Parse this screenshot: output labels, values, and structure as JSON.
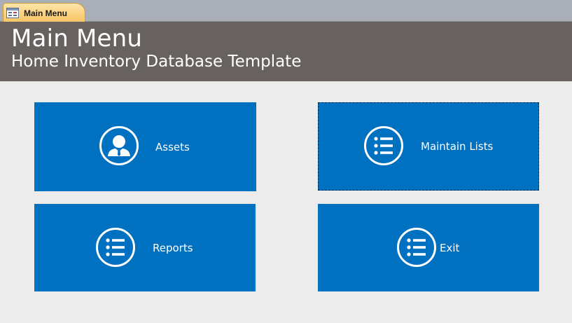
{
  "tab": {
    "label": "Main Menu",
    "icon": "form-icon"
  },
  "header": {
    "title": "Main Menu",
    "subtitle": "Home Inventory Database Template"
  },
  "buttons": {
    "assets": {
      "label": "Assets",
      "icon": "person-icon"
    },
    "maintain_lists": {
      "label": "Maintain Lists",
      "icon": "list-icon"
    },
    "reports": {
      "label": "Reports",
      "icon": "list-icon"
    },
    "exit": {
      "label": "Exit",
      "icon": "list-icon"
    }
  },
  "colors": {
    "tile": "#0070c0",
    "header": "#676260",
    "background": "#ececec",
    "tab_strip": "#a9aeb8",
    "tab_active": "#f7c463"
  }
}
